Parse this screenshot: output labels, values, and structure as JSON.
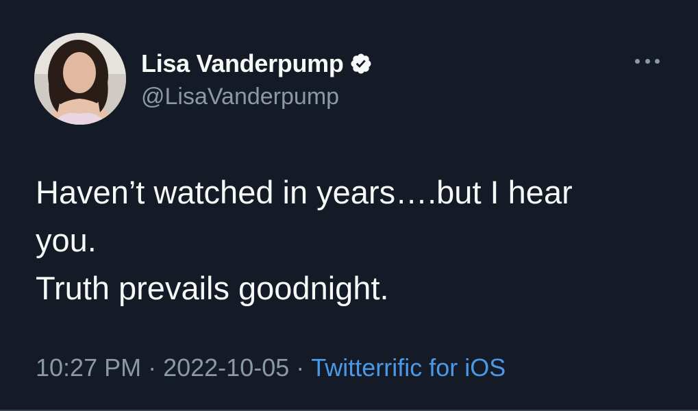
{
  "tweet": {
    "display_name": "Lisa Vanderpump",
    "handle": "@LisaVanderpump",
    "verified_icon": "verified-badge-icon",
    "more_icon": "more-options-icon",
    "body_lines": [
      "Haven’t watched in years….but I hear",
      "you.",
      "Truth prevails goodnight."
    ],
    "time": "10:27 PM",
    "separator": "·",
    "date": "2022-10-05",
    "source": "Twitterrific for iOS"
  },
  "colors": {
    "background": "#151b26",
    "primary_text": "#f7f9f9",
    "secondary_text": "#8b98a5",
    "link": "#4a99e9"
  }
}
